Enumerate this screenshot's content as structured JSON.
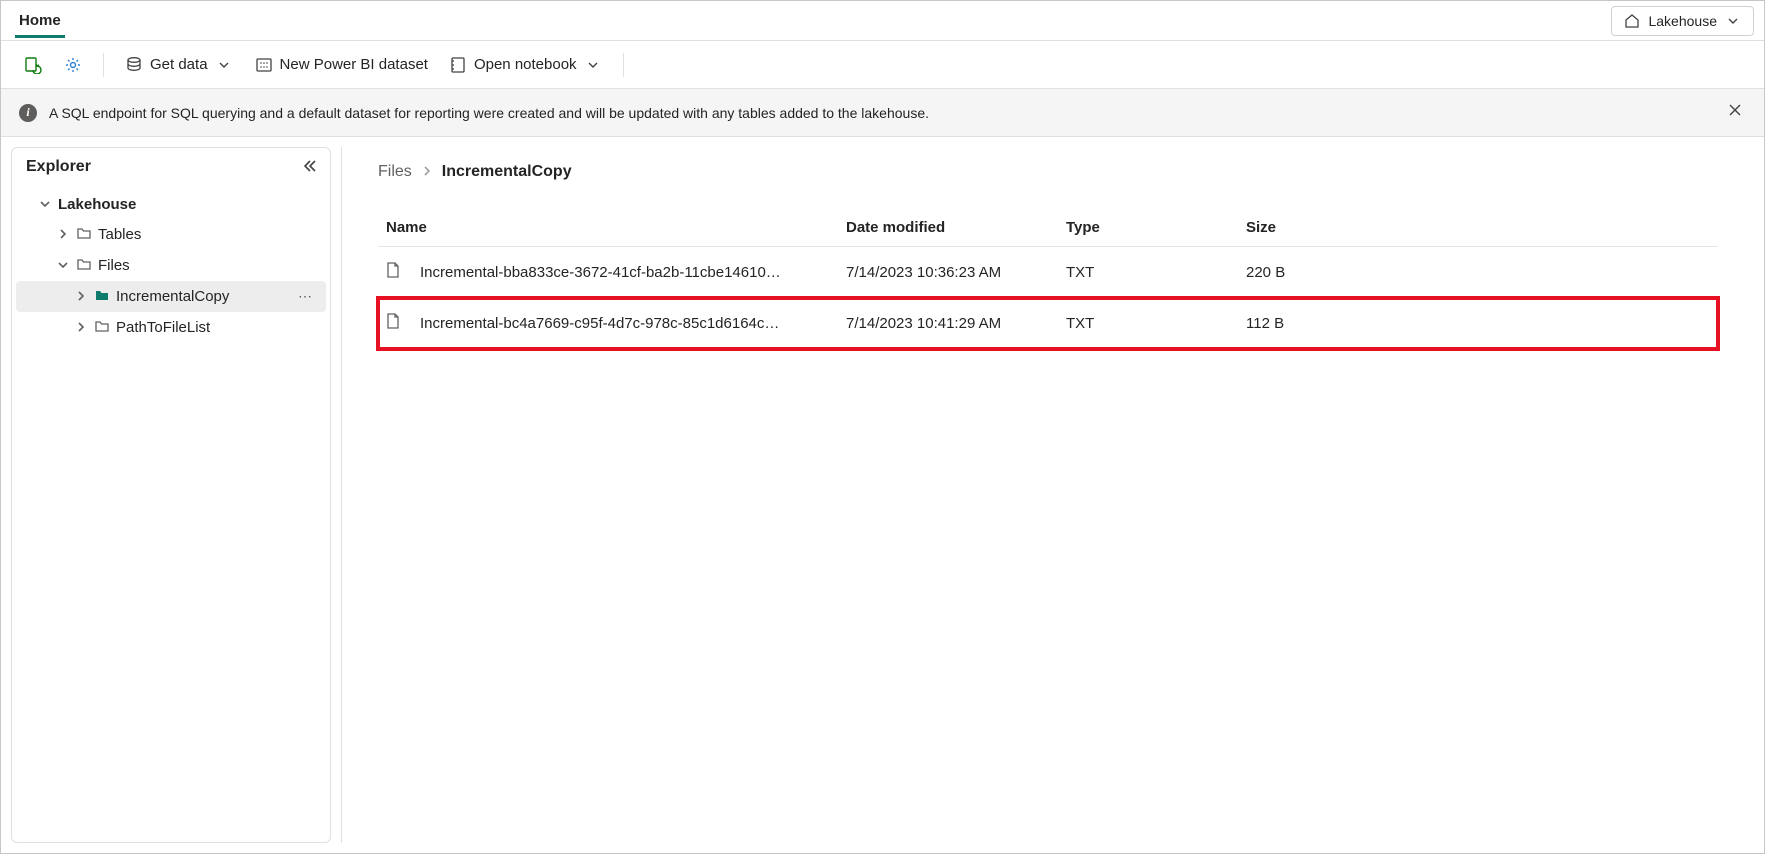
{
  "topbar": {
    "home_tab": "Home",
    "selector_label": "Lakehouse"
  },
  "toolbar": {
    "get_data": "Get data",
    "new_dataset": "New Power BI dataset",
    "open_notebook": "Open notebook"
  },
  "banner": {
    "message": "A SQL endpoint for SQL querying and a default dataset for reporting were created and will be updated with any tables added to the lakehouse."
  },
  "explorer": {
    "title": "Explorer",
    "root": "Lakehouse",
    "tables": "Tables",
    "files": "Files",
    "incremental": "IncrementalCopy",
    "pathtofile": "PathToFileList"
  },
  "breadcrumb": {
    "root": "Files",
    "current": "IncrementalCopy"
  },
  "table": {
    "headers": {
      "name": "Name",
      "date": "Date modified",
      "type": "Type",
      "size": "Size"
    },
    "rows": [
      {
        "name": "Incremental-bba833ce-3672-41cf-ba2b-11cbe14610…",
        "date": "7/14/2023 10:36:23 AM",
        "type": "TXT",
        "size": "220 B",
        "highlighted": false
      },
      {
        "name": "Incremental-bc4a7669-c95f-4d7c-978c-85c1d6164c…",
        "date": "7/14/2023 10:41:29 AM",
        "type": "TXT",
        "size": "112 B",
        "highlighted": true
      }
    ]
  }
}
